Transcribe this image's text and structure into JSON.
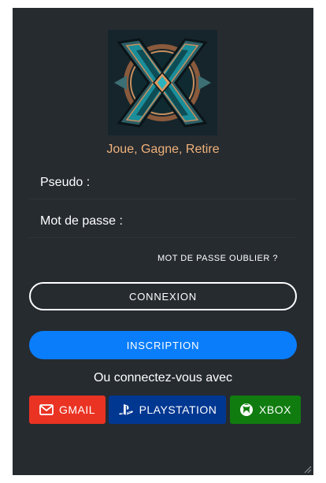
{
  "tagline": "Joue, Gagne, Retire",
  "form": {
    "pseudo_label": "Pseudo :",
    "pseudo_value": "",
    "password_label": "Mot de passe :",
    "password_value": "",
    "forgot_link": "MOT DE PASSE OUBLIER ?"
  },
  "buttons": {
    "connexion": "CONNEXION",
    "inscription": "INSCRIPTION"
  },
  "social": {
    "intro": "Ou connectez-vous avec",
    "gmail": "GMAIL",
    "playstation": "PLAYSTATION",
    "xbox": "XBOX"
  },
  "colors": {
    "card_background": "#262b30",
    "tagline": "#f0b27a",
    "inscription": "#0a7dfb",
    "gmail": "#ea3323",
    "playstation": "#003791",
    "xbox": "#107c10"
  },
  "icons": {
    "logo": "x-emblem-logo",
    "gmail": "mail-icon",
    "playstation": "playstation-icon",
    "xbox": "xbox-icon",
    "resize": "resize-grip-icon"
  }
}
